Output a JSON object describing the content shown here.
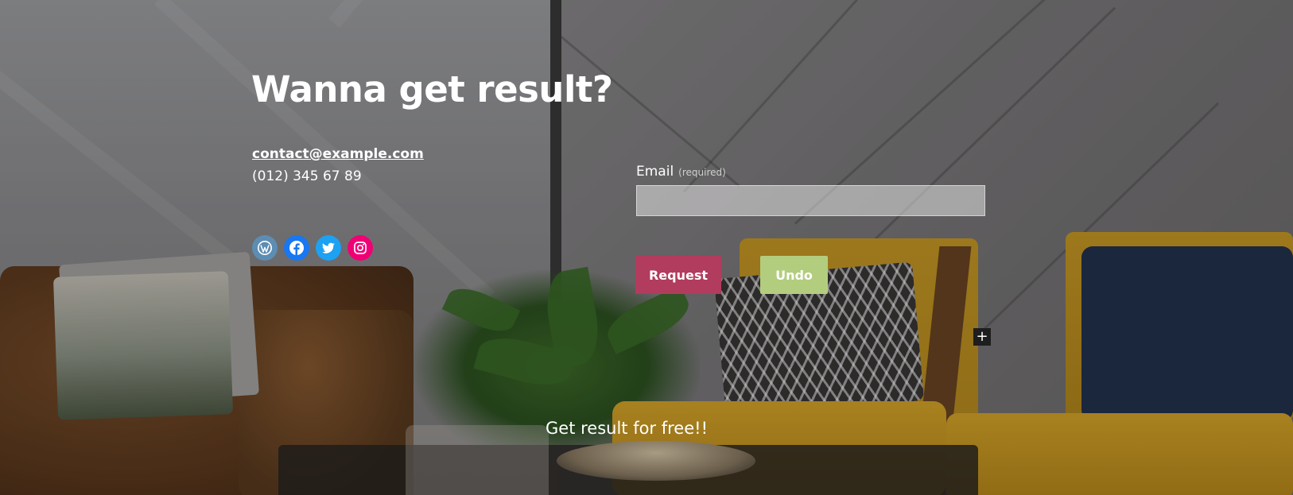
{
  "hero": {
    "headline": "Wanna get result?"
  },
  "contact": {
    "email": "contact@example.com",
    "phone": "(012) 345 67 89"
  },
  "social": [
    {
      "name": "wordpress-icon",
      "color": "#5d8db3"
    },
    {
      "name": "facebook-icon",
      "color": "#1877f2"
    },
    {
      "name": "twitter-icon",
      "color": "#1da1f2"
    },
    {
      "name": "instagram-icon",
      "color": "#f00075"
    }
  ],
  "form": {
    "email_label": "Email",
    "required_label": "(required)",
    "email_value": "",
    "request_label": "Request",
    "undo_label": "Undo"
  },
  "block_inserter": {
    "label": "+"
  },
  "footer": {
    "tagline": "Get result for free!!"
  },
  "colors": {
    "request_button": "#b23c5d",
    "undo_button": "#b3cd7e"
  }
}
